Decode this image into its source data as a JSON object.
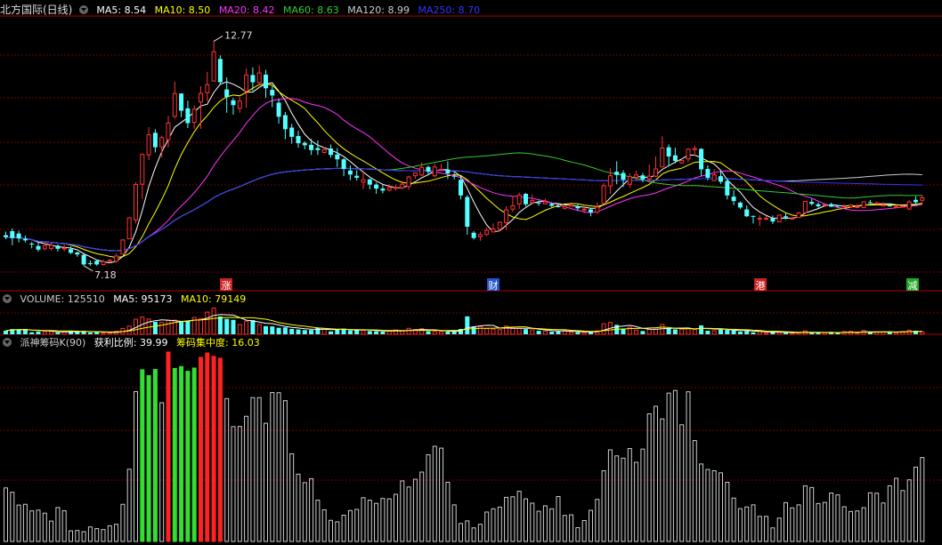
{
  "main_legend": {
    "title": "北方国际(日线)",
    "items": [
      {
        "label": "MA5: 8.54",
        "color": "#ffffff"
      },
      {
        "label": "MA10: 8.50",
        "color": "#ffff00"
      },
      {
        "label": "MA20: 8.42",
        "color": "#ff33ff"
      },
      {
        "label": "MA60: 8.63",
        "color": "#33cc33"
      },
      {
        "label": "MA120: 8.99",
        "color": "#cccccc"
      },
      {
        "label": "MA250: 8.70",
        "color": "#3333ff"
      }
    ]
  },
  "volume_legend": {
    "items": [
      {
        "label": "VOLUME: 125510",
        "color": "#cccccc"
      },
      {
        "label": "MA5: 95173",
        "color": "#ffffff"
      },
      {
        "label": "MA10: 79149",
        "color": "#ffff00"
      }
    ]
  },
  "indicator_legend": {
    "items": [
      {
        "label": "派神筹码K(90)",
        "color": "#cccccc"
      },
      {
        "label": "获利比例: 39.99",
        "color": "#ffffff"
      },
      {
        "label": "筹码集中度: 16.03",
        "color": "#ffff00"
      }
    ]
  },
  "annotations": {
    "high": "12.77",
    "low": "7.18"
  },
  "markers": [
    {
      "text": "涨",
      "color": "#cc2222"
    },
    {
      "text": "财",
      "color": "#2255cc"
    },
    {
      "text": "港",
      "color": "#cc2222"
    },
    {
      "text": "减",
      "color": "#22aa22"
    }
  ],
  "colors": {
    "up": "#ff3232",
    "down": "#54ffff",
    "grid": "#7a0000",
    "bar_gray": "#cccccc",
    "bar_green": "#33dd33",
    "bar_red": "#ff2222"
  },
  "chart_data": {
    "type": "candlestick",
    "price_range": [
      6.6,
      13.4
    ],
    "candles": [
      [
        7.94,
        7.89,
        8.03,
        7.84
      ],
      [
        8.04,
        7.87,
        8.11,
        7.69
      ],
      [
        7.98,
        7.86,
        8.05,
        7.76
      ],
      [
        7.85,
        7.81,
        7.93,
        7.76
      ],
      [
        7.73,
        7.71,
        7.77,
        7.61
      ],
      [
        7.67,
        7.58,
        7.77,
        7.53
      ],
      [
        7.6,
        7.68,
        7.75,
        7.56
      ],
      [
        7.61,
        7.69,
        7.74,
        7.56
      ],
      [
        7.68,
        7.6,
        7.71,
        7.53
      ],
      [
        7.61,
        7.62,
        7.71,
        7.54
      ],
      [
        7.59,
        7.5,
        7.66,
        7.47
      ],
      [
        7.51,
        7.46,
        7.53,
        7.4
      ],
      [
        7.45,
        7.21,
        7.5,
        7.18
      ],
      [
        7.24,
        7.23,
        7.31,
        7.18
      ],
      [
        7.3,
        7.21,
        7.33,
        7.18
      ],
      [
        7.21,
        7.28,
        7.33,
        7.18
      ],
      [
        7.29,
        7.31,
        7.35,
        7.24
      ],
      [
        7.29,
        7.42,
        7.49,
        7.25
      ],
      [
        7.47,
        7.82,
        7.84,
        7.46
      ],
      [
        7.85,
        8.37,
        8.39,
        7.84
      ],
      [
        8.32,
        9.2,
        9.26,
        8.23
      ],
      [
        9.21,
        9.95,
        9.98,
        8.84
      ],
      [
        9.94,
        10.44,
        10.63,
        9.81
      ],
      [
        10.49,
        10.13,
        10.58,
        10.0
      ],
      [
        10.14,
        10.37,
        10.42,
        9.88
      ],
      [
        10.32,
        10.73,
        10.91,
        10.13
      ],
      [
        10.9,
        11.47,
        11.76,
        10.84
      ],
      [
        11.47,
        11.04,
        11.47,
        10.88
      ],
      [
        11.1,
        10.73,
        11.29,
        10.61
      ],
      [
        10.75,
        11.08,
        11.17,
        10.59
      ],
      [
        11.26,
        11.47,
        11.65,
        10.59
      ],
      [
        11.49,
        11.69,
        12.01,
        11.28
      ],
      [
        11.78,
        12.51,
        12.77,
        11.78
      ],
      [
        12.33,
        11.75,
        12.42,
        11.7
      ],
      [
        11.57,
        11.38,
        11.87,
        10.99
      ],
      [
        11.3,
        11.18,
        11.36,
        10.94
      ],
      [
        11.1,
        11.28,
        11.38,
        10.99
      ],
      [
        11.53,
        11.93,
        12.09,
        11.12
      ],
      [
        11.93,
        11.75,
        12.12,
        11.54
      ],
      [
        11.74,
        11.98,
        12.17,
        11.66
      ],
      [
        11.94,
        11.6,
        12.06,
        11.36
      ],
      [
        11.56,
        11.42,
        11.66,
        11.13
      ],
      [
        11.24,
        10.89,
        11.34,
        10.72
      ],
      [
        10.93,
        10.58,
        11.01,
        10.33
      ],
      [
        10.62,
        10.39,
        10.71,
        10.22
      ],
      [
        10.41,
        10.23,
        10.54,
        10.12
      ],
      [
        10.24,
        10.18,
        10.28,
        10.08
      ],
      [
        10.19,
        10.06,
        10.34,
        9.94
      ],
      [
        10.11,
        10.06,
        10.3,
        9.94
      ],
      [
        10.0,
        10.07,
        10.13,
        9.98
      ],
      [
        10.1,
        9.94,
        10.2,
        9.87
      ],
      [
        9.95,
        9.83,
        10.11,
        9.64
      ],
      [
        9.83,
        9.59,
        9.86,
        9.41
      ],
      [
        9.55,
        9.45,
        9.68,
        9.31
      ],
      [
        9.42,
        9.37,
        9.56,
        9.3
      ],
      [
        9.26,
        9.32,
        9.55,
        9.09
      ],
      [
        9.33,
        9.2,
        9.35,
        9.08
      ],
      [
        9.2,
        9.1,
        9.25,
        8.97
      ],
      [
        9.1,
        9.05,
        9.19,
        8.98
      ],
      [
        9.06,
        9.12,
        9.21,
        9.03
      ],
      [
        9.13,
        9.13,
        9.2,
        9.05
      ],
      [
        9.12,
        9.21,
        9.29,
        9.07
      ],
      [
        9.15,
        9.39,
        9.42,
        9.07
      ],
      [
        9.42,
        9.49,
        9.49,
        9.34
      ],
      [
        9.44,
        9.63,
        9.75,
        9.41
      ],
      [
        9.64,
        9.52,
        9.67,
        9.43
      ],
      [
        9.42,
        9.64,
        9.72,
        9.38
      ],
      [
        9.58,
        9.58,
        9.72,
        9.54
      ],
      [
        9.56,
        9.48,
        9.78,
        9.34
      ],
      [
        9.42,
        9.4,
        9.49,
        9.33
      ],
      [
        9.32,
        8.93,
        9.39,
        8.83
      ],
      [
        8.89,
        8.15,
        8.94,
        7.95
      ],
      [
        8.0,
        7.87,
        8.04,
        7.83
      ],
      [
        7.9,
        7.95,
        8.02,
        7.8
      ],
      [
        7.96,
        8.06,
        8.13,
        7.92
      ],
      [
        8.02,
        8.09,
        8.23,
        8.01
      ],
      [
        8.09,
        8.26,
        8.28,
        8.04
      ],
      [
        8.25,
        8.57,
        8.67,
        8.07
      ],
      [
        8.59,
        8.67,
        8.92,
        8.52
      ],
      [
        8.72,
        8.94,
        9.0,
        8.59
      ],
      [
        8.97,
        8.71,
        8.99,
        8.66
      ],
      [
        8.75,
        8.8,
        8.96,
        8.71
      ],
      [
        8.75,
        8.74,
        8.8,
        8.67
      ],
      [
        8.72,
        8.77,
        8.85,
        8.72
      ],
      [
        8.72,
        8.67,
        8.76,
        8.64
      ],
      [
        8.66,
        8.65,
        8.74,
        8.63
      ],
      [
        8.61,
        8.65,
        8.67,
        8.57
      ],
      [
        8.66,
        8.69,
        8.72,
        8.65
      ],
      [
        8.65,
        8.61,
        8.7,
        8.55
      ],
      [
        8.57,
        8.59,
        8.66,
        8.49
      ],
      [
        8.58,
        8.51,
        8.6,
        8.41
      ],
      [
        8.51,
        8.64,
        8.76,
        8.47
      ],
      [
        8.73,
        9.17,
        9.24,
        8.72
      ],
      [
        9.17,
        9.42,
        9.61,
        8.97
      ],
      [
        9.52,
        9.44,
        9.78,
        9.21
      ],
      [
        9.49,
        9.32,
        9.56,
        9.14
      ],
      [
        9.21,
        9.4,
        9.48,
        9.12
      ],
      [
        9.38,
        9.44,
        9.55,
        9.3
      ],
      [
        9.43,
        9.33,
        9.49,
        9.26
      ],
      [
        9.34,
        9.41,
        9.7,
        9.25
      ],
      [
        9.41,
        9.59,
        9.9,
        9.38
      ],
      [
        9.64,
        10.11,
        10.4,
        9.64
      ],
      [
        10.13,
        9.9,
        10.2,
        9.65
      ],
      [
        9.93,
        9.79,
        10.12,
        9.73
      ],
      [
        9.74,
        9.8,
        9.84,
        9.73
      ],
      [
        9.84,
        10.08,
        10.11,
        9.76
      ],
      [
        10.07,
        10.1,
        10.17,
        9.92
      ],
      [
        10.09,
        9.58,
        10.11,
        9.42
      ],
      [
        9.59,
        9.37,
        9.68,
        9.31
      ],
      [
        9.3,
        9.44,
        9.59,
        9.29
      ],
      [
        9.41,
        9.27,
        9.55,
        9.22
      ],
      [
        9.29,
        8.93,
        9.36,
        8.83
      ],
      [
        8.9,
        8.79,
        9.06,
        8.69
      ],
      [
        8.75,
        8.63,
        8.78,
        8.59
      ],
      [
        8.58,
        8.41,
        8.68,
        8.39
      ],
      [
        8.42,
        8.4,
        8.43,
        8.23
      ],
      [
        8.36,
        8.36,
        8.44,
        8.17
      ],
      [
        8.34,
        8.36,
        8.42,
        8.32
      ],
      [
        8.36,
        8.28,
        8.43,
        8.22
      ],
      [
        8.27,
        8.44,
        8.46,
        8.26
      ],
      [
        8.41,
        8.38,
        8.5,
        8.33
      ],
      [
        8.35,
        8.36,
        8.4,
        8.34
      ],
      [
        8.38,
        8.49,
        8.53,
        8.37
      ],
      [
        8.5,
        8.78,
        8.79,
        8.48
      ],
      [
        8.77,
        8.72,
        8.84,
        8.68
      ],
      [
        8.71,
        8.66,
        8.76,
        8.62
      ],
      [
        8.69,
        8.71,
        8.73,
        8.65
      ],
      [
        8.71,
        8.65,
        8.75,
        8.64
      ],
      [
        8.68,
        8.66,
        8.69,
        8.62
      ],
      [
        8.64,
        8.66,
        8.71,
        8.63
      ],
      [
        8.65,
        8.69,
        8.71,
        8.63
      ],
      [
        8.63,
        8.65,
        8.72,
        8.61
      ],
      [
        8.63,
        8.77,
        8.77,
        8.61
      ],
      [
        8.76,
        8.75,
        8.82,
        8.73
      ],
      [
        8.74,
        8.74,
        8.78,
        8.71
      ],
      [
        8.67,
        8.69,
        8.76,
        8.67
      ],
      [
        8.68,
        8.66,
        8.72,
        8.65
      ],
      [
        8.65,
        8.65,
        8.69,
        8.61
      ],
      [
        8.66,
        8.66,
        8.72,
        8.63
      ],
      [
        8.59,
        8.77,
        8.81,
        8.57
      ],
      [
        8.82,
        8.76,
        8.91,
        8.72
      ],
      [
        8.81,
        8.87,
        8.94,
        8.77
      ]
    ],
    "volume": [
      35,
      51,
      48,
      52,
      20,
      29,
      26,
      27,
      17,
      23,
      29,
      31,
      33,
      17,
      21,
      12,
      13,
      29,
      57,
      80,
      147,
      168,
      149,
      121,
      116,
      135,
      138,
      120,
      131,
      165,
      153,
      216,
      255,
      174,
      150,
      141,
      95,
      128,
      138,
      96,
      80,
      77,
      64,
      67,
      52,
      47,
      41,
      42,
      62,
      55,
      28,
      46,
      54,
      37,
      41,
      40,
      32,
      28,
      26,
      31,
      42,
      34,
      58,
      47,
      54,
      30,
      27,
      26,
      27,
      32,
      52,
      175,
      77,
      77,
      55,
      51,
      45,
      80,
      60,
      58,
      50,
      44,
      34,
      32,
      26,
      29,
      38,
      21,
      21,
      17,
      23,
      34,
      103,
      116,
      92,
      56,
      69,
      41,
      32,
      50,
      51,
      96,
      56,
      48,
      51,
      58,
      46,
      87,
      35,
      35,
      45,
      43,
      35,
      26,
      32,
      19,
      27,
      9,
      26,
      21,
      16,
      12,
      13,
      34,
      16,
      14,
      15,
      19,
      15,
      26,
      28,
      12,
      38,
      19,
      23,
      24,
      22,
      16,
      27,
      39,
      34,
      25
    ],
    "indicator": {
      "series": "获利比例",
      "values": [
        28.4,
        26.1,
        19.3,
        19.7,
        16.2,
        16.6,
        15.0,
        10.8,
        18.0,
        16.3,
        5.6,
        5.8,
        5.2,
        7.7,
        6.8,
        6.3,
        8.3,
        9.1,
        19.7,
        38.3,
        79.5,
        91.1,
        88.0,
        91.3,
        73.6,
        100.5,
        91.8,
        92.8,
        90.3,
        92.0,
        97.7,
        100.0,
        98.2,
        97.2,
        75.8,
        60.9,
        61.0,
        66.4,
        76.3,
        76.3,
        62.7,
        79.0,
        78.9,
        74.7,
        46.5,
        35.7,
        31.2,
        33.3,
        21.9,
        16.8,
        11.2,
        10.4,
        13.9,
        16.4,
        17.0,
        23.2,
        21.9,
        20.2,
        22.8,
        22.6,
        25.0,
        32.1,
        28.9,
        33.0,
        36.8,
        46.0,
        50.5,
        49.5,
        31.4,
        19.4,
        9.5,
        10.9,
        7.2,
        9.1,
        15.6,
        17.3,
        18.2,
        23.4,
        23.7,
        26.6,
        22.6,
        20.3,
        16.0,
        18.9,
        17.3,
        23.8,
        13.8,
        14.1,
        7.3,
        11.1,
        16.5,
        22.3,
        37.5,
        48.6,
        45.4,
        44.2,
        49.3,
        42.0,
        49.0,
        67.7,
        71.7,
        65.0,
        78.7,
        80.1,
        61.9,
        79.4,
        53.5,
        41.1,
        38.2,
        37.5,
        36.4,
        31.4,
        23.0,
        17.4,
        18.3,
        19.4,
        13.3,
        13.3,
        7.2,
        12.4,
        20.6,
        17.8,
        19.4,
        29.5,
        28.6,
        20.1,
        20.7,
        25.7,
        24.7,
        18.4,
        15.9,
        16.2,
        17.9,
        25.8,
        25.6,
        20.4,
        29.5,
        33.5,
        27.0,
        32.7,
        39.4,
        44.5
      ]
    }
  }
}
